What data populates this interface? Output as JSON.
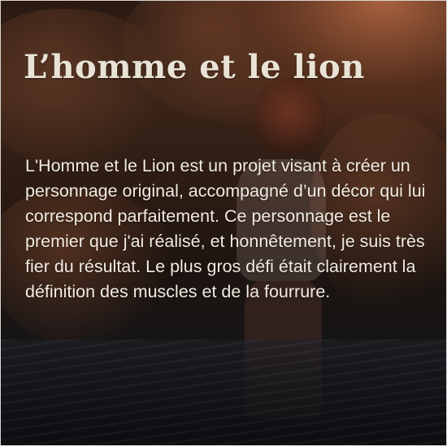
{
  "card": {
    "title": "L’homme et le lion",
    "description": "L'Homme et le Lion est un projet visant à créer un personnage original, accompagné d’un décor qui lui correspond parfaitement. Ce personnage est le premier que j'ai réalisé, et honnêtement, je suis très fier du résultat. Le plus gros défi était clairement la définition des muscles et de la fourrure."
  },
  "colors": {
    "title_text": "#e9e3d6",
    "body_text": "#f1ebe2",
    "background_dark": "#1a1512",
    "sky_glow": "#be6e46"
  }
}
